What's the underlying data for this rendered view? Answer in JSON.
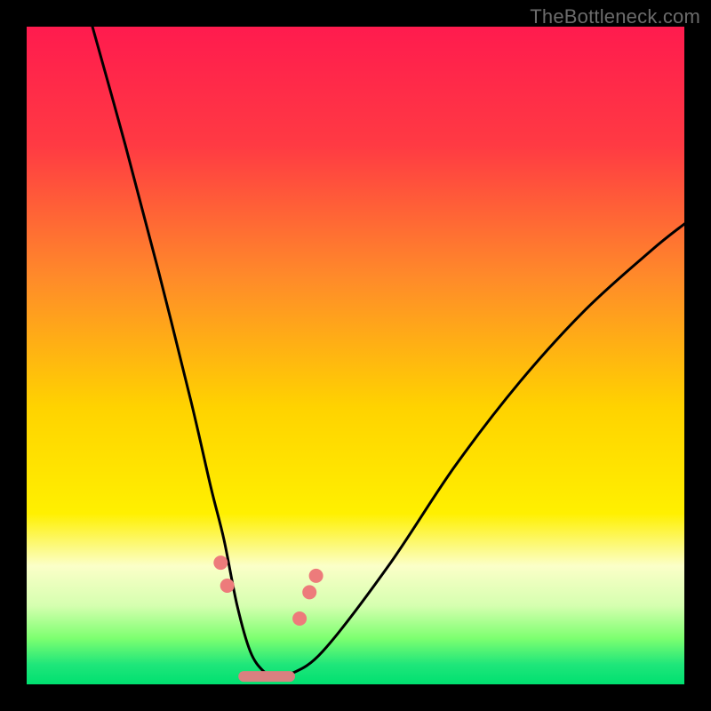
{
  "attribution": "TheBottleneck.com",
  "colors": {
    "top": "#ff1e4e",
    "mid_upper": "#ff7a2a",
    "mid": "#ffd400",
    "mid_lower": "#fff06a",
    "low_pale": "#fbffd0",
    "green_light": "#7cff62",
    "green_bottom": "#00e06f",
    "curve": "#000000",
    "dot": "#ed7b7b",
    "trough_fill": "#d98080"
  },
  "gradient_stops": [
    {
      "offset": "0%",
      "color": "#ff1b4e"
    },
    {
      "offset": "18%",
      "color": "#ff3a43"
    },
    {
      "offset": "38%",
      "color": "#ff8a2a"
    },
    {
      "offset": "58%",
      "color": "#ffd300"
    },
    {
      "offset": "74%",
      "color": "#fff000"
    },
    {
      "offset": "82%",
      "color": "#fbffc8"
    },
    {
      "offset": "88%",
      "color": "#d6ffb0"
    },
    {
      "offset": "93%",
      "color": "#7dff70"
    },
    {
      "offset": "97%",
      "color": "#1fe67a"
    },
    {
      "offset": "100%",
      "color": "#00e070"
    }
  ],
  "chart_data": {
    "type": "line",
    "title": "",
    "xlabel": "",
    "ylabel": "",
    "xlim": [
      0,
      100
    ],
    "ylim": [
      0,
      100
    ],
    "series": [
      {
        "name": "bottleneck-curve",
        "x": [
          10,
          15,
          20,
          25,
          28,
          30,
          32,
          34,
          36,
          38,
          40,
          45,
          55,
          65,
          75,
          85,
          95,
          100
        ],
        "y": [
          100,
          82,
          63,
          43,
          30,
          22,
          12,
          5,
          2,
          1,
          1.5,
          5,
          18,
          33,
          46,
          57,
          66,
          70
        ]
      }
    ],
    "markers": [
      {
        "x": 29.5,
        "y": 18.5
      },
      {
        "x": 30.5,
        "y": 15.0
      },
      {
        "x": 41.5,
        "y": 10.0
      },
      {
        "x": 43.0,
        "y": 14.0
      },
      {
        "x": 44.0,
        "y": 16.5
      }
    ],
    "trough_band": {
      "x_start": 33,
      "x_end": 40,
      "y": 1.2
    },
    "notes": "x and y are in percent of the plot area; y measured from bottom. Curve is a stylized V-shaped bottleneck plot on a vertical rainbow gradient (red at top → green at bottom). No axis ticks or numeric labels are present in the source image; values are visual estimates."
  }
}
